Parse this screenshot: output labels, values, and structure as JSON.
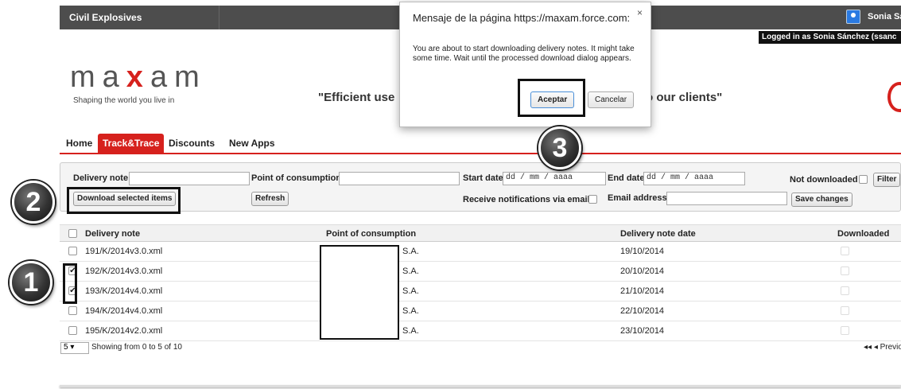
{
  "topbar": {
    "app_name": "Civil Explosives",
    "user_name": "Sonia Sá",
    "logged_in": "Logged in as Sonia Sánchez (ssanc"
  },
  "header": {
    "logo_text": [
      "m",
      "a",
      "x",
      "a",
      "m"
    ],
    "tagline": "Shaping the world you live in",
    "slogan_left": "\"Efficient use",
    "slogan_right": "o our clients\""
  },
  "nav": {
    "items": [
      "Home",
      "Track&Trace",
      "Discounts",
      "New Apps"
    ],
    "active": "Track&Trace"
  },
  "filters": {
    "delivery_note_label": "Delivery note",
    "point_label": "Point of consumption",
    "start_date_label": "Start date",
    "start_date_placeholder": "dd / mm / aaaa",
    "end_date_label": "End date",
    "end_date_placeholder": "dd / mm / aaaa",
    "not_downloaded_label": "Not downloaded",
    "filter_button": "Filter",
    "download_button": "Download selected items",
    "refresh_button": "Refresh",
    "notify_label": "Receive notifications via email",
    "email_label": "Email address",
    "save_button": "Save changes"
  },
  "table": {
    "headers": {
      "delivery_note": "Delivery note",
      "point": "Point of consumption",
      "date": "Delivery note date",
      "downloaded": "Downloaded"
    },
    "rows": [
      {
        "note": "191/K/2014v3.0.xml",
        "point": "S.A.",
        "date": "19/10/2014",
        "checked": false
      },
      {
        "note": "192/K/2014v3.0.xml",
        "point": "S.A.",
        "date": "20/10/2014",
        "checked": true
      },
      {
        "note": "193/K/2014v4.0.xml",
        "point": "S.A.",
        "date": "21/10/2014",
        "checked": true
      },
      {
        "note": "194/K/2014v4.0.xml",
        "point": "S.A.",
        "date": "22/10/2014",
        "checked": false
      },
      {
        "note": "195/K/2014v2.0.xml",
        "point": "S.A.",
        "date": "23/10/2014",
        "checked": false
      }
    ]
  },
  "pager": {
    "page_size": "5",
    "showing": "Showing from 0 to 5 of 10",
    "prev": "◂◂ ◂ Previo"
  },
  "dialog": {
    "title": "Mensaje de la página https://maxam.force.com:",
    "message": "You are about to start downloading delivery notes. It might take some time. Wait until the processed download dialog appears.",
    "ok": "Aceptar",
    "cancel": "Cancelar",
    "close": "×"
  },
  "steps": [
    "1",
    "2",
    "3"
  ],
  "colors": {
    "brand_red": "#d6211d",
    "topbar": "#4d4d4d"
  }
}
